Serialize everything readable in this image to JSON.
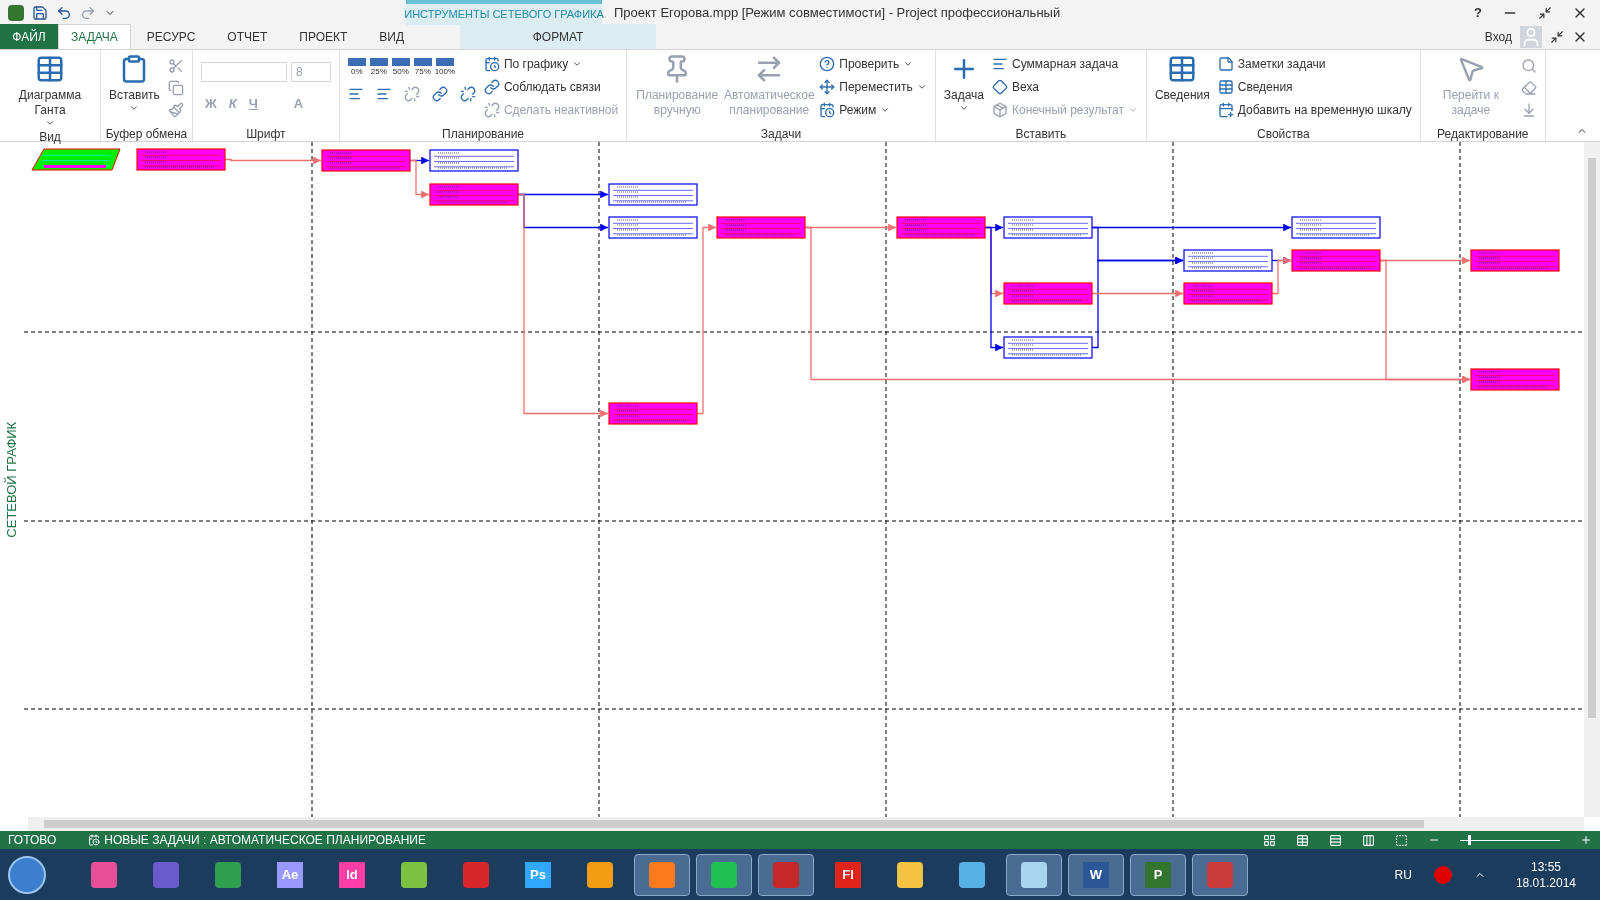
{
  "title_bar": {
    "context_header": "ИНСТРУМЕНТЫ СЕТЕВОГО ГРАФИКА",
    "title": "Проект Егорова.mpp [Режим совместимости] - Project профессиональный",
    "help": "?"
  },
  "tabs": [
    {
      "label": "ФАЙЛ",
      "kind": "file",
      "selected": false
    },
    {
      "label": "ЗАДАЧА",
      "kind": "tab",
      "selected": true
    },
    {
      "label": "РЕСУРС",
      "kind": "tab",
      "selected": false
    },
    {
      "label": "ОТЧЕТ",
      "kind": "tab",
      "selected": false
    },
    {
      "label": "ПРОЕКТ",
      "kind": "tab",
      "selected": false
    },
    {
      "label": "ВИД",
      "kind": "tab",
      "selected": false
    },
    {
      "label": "ФОРМАТ",
      "kind": "context",
      "selected": false
    }
  ],
  "account": {
    "label": "Вход"
  },
  "ribbon": {
    "groups": [
      {
        "label": "Вид",
        "items": [
          {
            "kind": "large",
            "label": "Диаграмма Ганта",
            "disabled": false,
            "dropdown": true
          }
        ]
      },
      {
        "label": "Буфер обмена",
        "items": [
          {
            "kind": "large",
            "label": "Вставить",
            "disabled": false,
            "dropdown": true
          },
          {
            "kind": "iconcol"
          }
        ]
      },
      {
        "label": "Шрифт",
        "items": [
          {
            "kind": "font",
            "size": "8",
            "styles": [
              "Ж",
              "К",
              "Ч"
            ],
            "color_letter": "A"
          }
        ]
      },
      {
        "label": "Планирование",
        "items": [
          {
            "kind": "percent",
            "values": [
              "0%",
              "25%",
              "50%",
              "75%",
              "100%"
            ]
          },
          {
            "kind": "smallcol",
            "entries": [
              {
                "label": "По графику",
                "disabled": false,
                "dropdown": true
              },
              {
                "label": "Соблюдать связи",
                "disabled": false,
                "dropdown": false
              },
              {
                "label": "Сделать неактивной",
                "disabled": true,
                "dropdown": false
              }
            ]
          }
        ]
      },
      {
        "label": "Задачи",
        "items": [
          {
            "kind": "large",
            "label": "Планирование вручную",
            "disabled": true,
            "dropdown": false
          },
          {
            "kind": "large",
            "label": "Автоматическое планирование",
            "disabled": true,
            "dropdown": false
          },
          {
            "kind": "smallcol",
            "entries": [
              {
                "label": "Проверить",
                "disabled": false,
                "dropdown": true
              },
              {
                "label": "Переместить",
                "disabled": false,
                "dropdown": true
              },
              {
                "label": "Режим",
                "disabled": false,
                "dropdown": true
              }
            ]
          }
        ]
      },
      {
        "label": "Вставить",
        "items": [
          {
            "kind": "large",
            "label": "Задача",
            "disabled": false,
            "dropdown": true
          },
          {
            "kind": "smallcol",
            "entries": [
              {
                "label": "Суммарная задача",
                "disabled": false,
                "dropdown": false
              },
              {
                "label": "Веха",
                "disabled": false,
                "dropdown": false
              },
              {
                "label": "Конечный результат",
                "disabled": true,
                "dropdown": true
              }
            ]
          }
        ]
      },
      {
        "label": "Свойства",
        "items": [
          {
            "kind": "large",
            "label": "Сведения",
            "disabled": false,
            "dropdown": false
          },
          {
            "kind": "smallcol",
            "entries": [
              {
                "label": "Заметки задачи",
                "disabled": false,
                "dropdown": false
              },
              {
                "label": "Сведения",
                "disabled": false,
                "dropdown": false
              },
              {
                "label": "Добавить на временную шкалу",
                "disabled": false,
                "dropdown": false
              }
            ]
          }
        ]
      },
      {
        "label": "Редактирование",
        "items": [
          {
            "kind": "large",
            "label": "Перейти к задаче",
            "disabled": true,
            "dropdown": false
          },
          {
            "kind": "iconcol"
          }
        ]
      }
    ]
  },
  "view_label": "СЕТЕВОЙ ГРАФИК",
  "network": {
    "nodes": [
      {
        "kind": "summary"
      },
      {
        "kind": "critical"
      },
      {
        "kind": "critical"
      },
      {
        "kind": "normal"
      },
      {
        "kind": "critical"
      },
      {
        "kind": "normal"
      },
      {
        "kind": "normal"
      },
      {
        "kind": "critical"
      },
      {
        "kind": "critical"
      },
      {
        "kind": "critical"
      },
      {
        "kind": "normal"
      },
      {
        "kind": "critical"
      },
      {
        "kind": "normal"
      },
      {
        "kind": "normal"
      },
      {
        "kind": "critical"
      },
      {
        "kind": "normal"
      },
      {
        "kind": "critical"
      },
      {
        "kind": "critical"
      },
      {
        "kind": "critical"
      }
    ]
  },
  "status_bar": {
    "ready": "ГОТОВО",
    "mode": "НОВЫЕ ЗАДАЧИ : АВТОМАТИЧЕСКОЕ ПЛАНИРОВАНИЕ",
    "zoom": {
      "level": 0.08
    }
  },
  "taskbar": {
    "apps": [
      {
        "color": "#e84e9a",
        "selected": false
      },
      {
        "color": "#6a5acd",
        "selected": false
      },
      {
        "color": "#2e9e4f",
        "selected": false
      },
      {
        "label": "Ae",
        "color": "#9999ff",
        "selected": false
      },
      {
        "label": "Id",
        "color": "#ff3da6",
        "selected": false
      },
      {
        "color": "#7cc242",
        "selected": false
      },
      {
        "color": "#d8262a",
        "selected": false
      },
      {
        "label": "Ps",
        "color": "#31a8ff",
        "selected": false
      },
      {
        "color": "#f39c12",
        "selected": false
      },
      {
        "color": "#ff7a1a",
        "selected": true
      },
      {
        "color": "#20c050",
        "selected": true
      },
      {
        "color": "#c62828",
        "selected": true
      },
      {
        "label": "Fl",
        "color": "#e2231a",
        "selected": false
      },
      {
        "color": "#f5c342",
        "selected": false
      },
      {
        "color": "#57b0e6",
        "selected": false
      },
      {
        "color": "#a9d6ee",
        "selected": true
      },
      {
        "label": "W",
        "color": "#2b5797",
        "selected": true
      },
      {
        "label": "P",
        "color": "#31752f",
        "selected": true
      },
      {
        "color": "#cc3b3b",
        "selected": true
      }
    ],
    "language": "RU",
    "time": "13:55",
    "date": "18.01.2014"
  }
}
